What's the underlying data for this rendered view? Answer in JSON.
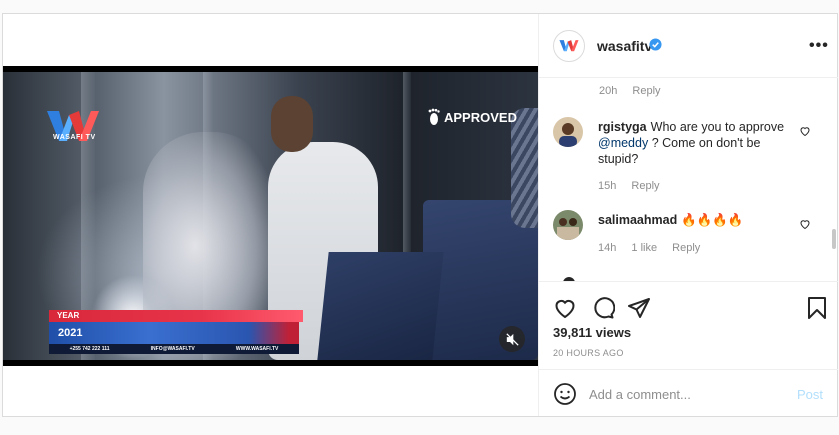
{
  "video": {
    "channel_logo_text": "WASAFI TV",
    "watermark": "APPROVED",
    "lower_third": {
      "label": "YEAR",
      "value": "2021",
      "phone": "+255 742 222 111",
      "email": "INFO@WASAFI.TV",
      "website": "WWW.WASAFI.TV"
    },
    "mute_icon": "speaker-muted-icon"
  },
  "header": {
    "username": "wasafitv",
    "verified": true,
    "more_label": "•••"
  },
  "comments": {
    "first_meta": {
      "time": "20h",
      "reply": "Reply"
    },
    "items": [
      {
        "user": "rgistyga",
        "text_before": "Who are you to approve ",
        "mention": "@meddy",
        "text_after": " ? Come on don't be stupid?",
        "time": "15h",
        "likes": "",
        "reply": "Reply"
      },
      {
        "user": "salimaahmad",
        "text": "🔥🔥🔥🔥",
        "time": "14h",
        "likes": "1 like",
        "reply": "Reply"
      }
    ]
  },
  "actions": {
    "like_icon": "heart-icon",
    "comment_icon": "comment-icon",
    "share_icon": "share-icon",
    "save_icon": "bookmark-icon",
    "views": "39,811 views",
    "posted": "20 HOURS AGO"
  },
  "add_comment": {
    "placeholder": "Add a comment...",
    "post_label": "Post"
  },
  "colors": {
    "verified_blue": "#3897f0",
    "post_disabled": "#b2dffc",
    "mention": "#00376b"
  }
}
